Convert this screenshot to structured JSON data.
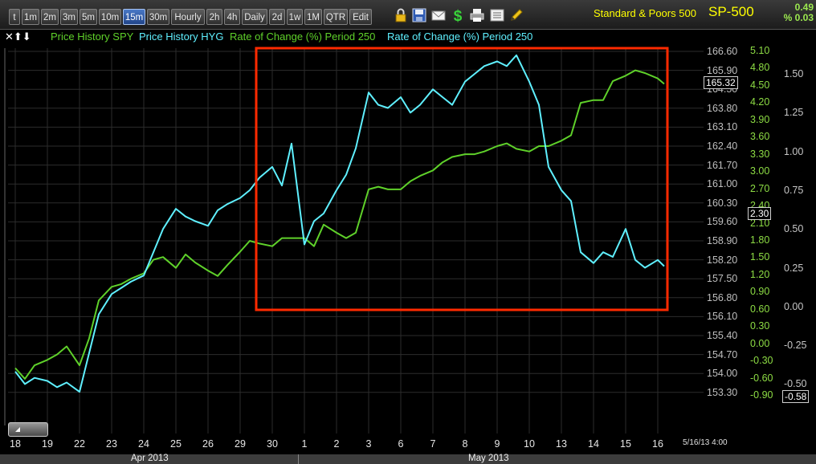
{
  "toolbar": {
    "timeframes": [
      "t",
      "1m",
      "2m",
      "3m",
      "5m",
      "10m",
      "15m",
      "30m",
      "Hourly",
      "2h",
      "4h",
      "Daily",
      "2d",
      "1w",
      "1M",
      "QTR",
      "Edit"
    ],
    "active_timeframe": "15m",
    "icons": [
      "lock-icon",
      "save-icon",
      "mail-icon",
      "dollar-icon",
      "print-icon",
      "list-icon",
      "pencil-icon"
    ]
  },
  "symbol": {
    "name": "Standard & Poors 500",
    "ticker": "SP-500",
    "change": "0.49",
    "change_pct": "% 0.03"
  },
  "legend": {
    "controls": "✕⬆⬇",
    "items": [
      {
        "label": "Price History SPY",
        "color": "#5fd12a"
      },
      {
        "label": "Price History HYG",
        "color": "#5ff0ff"
      },
      {
        "label": "Rate of Change (%) Period 250",
        "color": "#5fd12a"
      },
      {
        "label": "Rate of Change (%) Period 250",
        "color": "#5ff0ff"
      }
    ]
  },
  "chart_data": {
    "type": "line",
    "title": "",
    "x_ticks": [
      "18",
      "19",
      "22",
      "23",
      "24",
      "25",
      "26",
      "29",
      "30",
      "1",
      "2",
      "3",
      "6",
      "7",
      "8",
      "9",
      "10",
      "13",
      "14",
      "15",
      "16"
    ],
    "months": [
      "Apr 2013",
      "May 2013"
    ],
    "timestamp": "5/16/13 4:00",
    "y_axis_price": [
      "166.60",
      "165.90",
      "164.50",
      "163.80",
      "163.10",
      "162.40",
      "161.70",
      "161.00",
      "160.30",
      "159.60",
      "158.90",
      "158.20",
      "157.50",
      "156.80",
      "156.10",
      "155.40",
      "154.70",
      "154.00",
      "153.30"
    ],
    "y_axis_spy_roc": [
      "5.10",
      "4.80",
      "4.50",
      "4.20",
      "3.90",
      "3.60",
      "3.30",
      "3.00",
      "2.70",
      "2.40",
      "2.10",
      "1.80",
      "1.50",
      "1.20",
      "0.90",
      "0.60",
      "0.30",
      "0.00",
      "-0.30",
      "-0.60",
      "-0.90"
    ],
    "y_axis_hyg_roc": [
      "1.50",
      "1.25",
      "1.00",
      "0.75",
      "0.50",
      "0.25",
      "0.00",
      "-0.25",
      "-0.50"
    ],
    "current_values": {
      "price": "165.32",
      "spy_roc": "2.30",
      "hyg_roc": "-0.58"
    },
    "series": [
      {
        "name": "Price History SPY",
        "color": "#5fd12a",
        "x": [
          0,
          0.3,
          0.6,
          1,
          1.3,
          1.6,
          2,
          2.3,
          2.6,
          3,
          3.3,
          3.6,
          4,
          4.3,
          4.6,
          5,
          5.3,
          5.6,
          6,
          6.3,
          6.6,
          7,
          7.3,
          7.6,
          8,
          8.3,
          8.6,
          9,
          9.3,
          9.6,
          10,
          10.3,
          10.6,
          11,
          11.3,
          11.6,
          12,
          12.3,
          12.6,
          13,
          13.3,
          13.6,
          14,
          14.3,
          14.6,
          15,
          15.3,
          15.6,
          16,
          16.3,
          16.6,
          17,
          17.3,
          17.6,
          18,
          18.3,
          18.6,
          19,
          19.3,
          19.6,
          20,
          20.2
        ],
        "y": [
          154.9,
          154.5,
          155.0,
          155.2,
          155.4,
          155.7,
          155.0,
          156.0,
          157.4,
          157.9,
          158.0,
          158.2,
          158.4,
          158.9,
          159.0,
          158.6,
          159.1,
          158.8,
          158.5,
          158.3,
          158.7,
          159.2,
          159.6,
          159.5,
          159.4,
          159.7,
          159.7,
          159.7,
          159.4,
          160.2,
          159.9,
          159.7,
          159.9,
          161.5,
          161.6,
          161.5,
          161.5,
          161.8,
          162.0,
          162.2,
          162.5,
          162.7,
          162.8,
          162.8,
          162.9,
          163.1,
          163.2,
          163.0,
          162.9,
          163.1,
          163.1,
          163.3,
          163.5,
          164.7,
          164.8,
          164.8,
          165.5,
          165.7,
          165.9,
          165.8,
          165.6,
          165.4
        ]
      },
      {
        "name": "Price History HYG",
        "color": "#5ff0ff",
        "x": [
          0,
          0.3,
          0.6,
          1,
          1.3,
          1.6,
          2,
          2.3,
          2.6,
          3,
          3.3,
          3.6,
          4,
          4.3,
          4.6,
          5,
          5.3,
          5.6,
          6,
          6.3,
          6.6,
          7,
          7.3,
          7.6,
          8,
          8.3,
          8.6,
          9,
          9.3,
          9.6,
          10,
          10.3,
          10.6,
          11,
          11.3,
          11.6,
          12,
          12.3,
          12.6,
          13,
          13.3,
          13.6,
          14,
          14.3,
          14.6,
          15,
          15.3,
          15.6,
          16,
          16.3,
          16.6,
          17,
          17.3,
          17.6,
          18,
          18.3,
          18.6,
          19,
          19.3,
          19.6,
          20,
          20.2
        ],
        "y": [
          -0.42,
          -0.5,
          -0.46,
          -0.48,
          -0.52,
          -0.49,
          -0.55,
          -0.3,
          -0.05,
          0.08,
          0.12,
          0.16,
          0.2,
          0.35,
          0.5,
          0.63,
          0.58,
          0.55,
          0.52,
          0.62,
          0.66,
          0.7,
          0.75,
          0.83,
          0.9,
          0.78,
          1.05,
          0.4,
          0.55,
          0.6,
          0.75,
          0.85,
          1.02,
          1.38,
          1.3,
          1.28,
          1.35,
          1.25,
          1.3,
          1.4,
          1.35,
          1.3,
          1.45,
          1.5,
          1.55,
          1.58,
          1.55,
          1.62,
          1.45,
          1.3,
          0.9,
          0.75,
          0.68,
          0.35,
          0.28,
          0.35,
          0.32,
          0.5,
          0.3,
          0.25,
          0.3,
          0.26
        ]
      }
    ],
    "highlight_box": {
      "from_x": "7.5",
      "to_x": "20.3",
      "color": "#ff2a00"
    }
  }
}
